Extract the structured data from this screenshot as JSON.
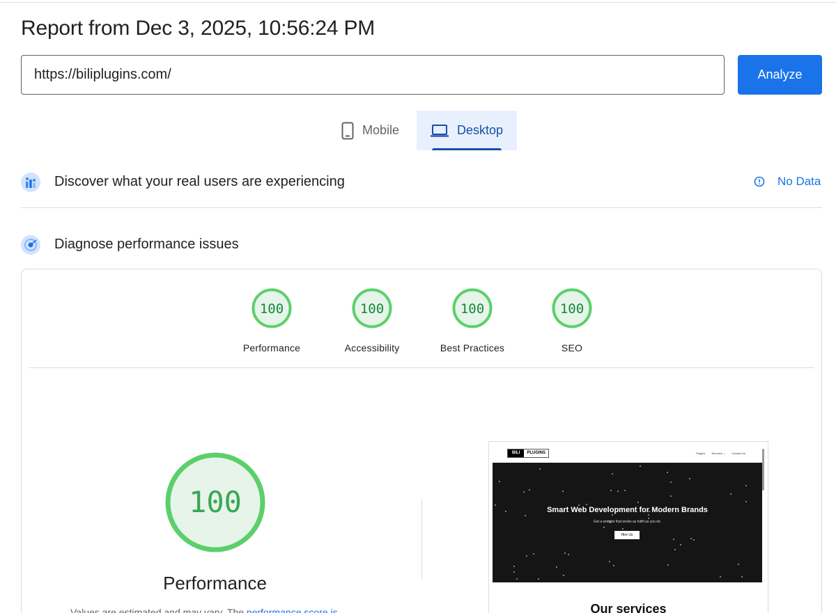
{
  "report": {
    "title": "Report from Dec 3, 2025, 10:56:24 PM"
  },
  "url_input": {
    "value": "https://biliplugins.com/"
  },
  "analyze_label": "Analyze",
  "tabs": [
    {
      "label": "Mobile",
      "icon": "phone-icon",
      "selected": false
    },
    {
      "label": "Desktop",
      "icon": "laptop-icon",
      "selected": true
    }
  ],
  "crux": {
    "title": "Discover what your real users are experiencing",
    "status": "No Data",
    "status_icon": "info-icon"
  },
  "diagnose": {
    "title": "Diagnose performance issues"
  },
  "scores": [
    {
      "label": "Performance",
      "value": "100"
    },
    {
      "label": "Accessibility",
      "value": "100"
    },
    {
      "label": "Best Practices",
      "value": "100"
    },
    {
      "label": "SEO",
      "value": "100"
    }
  ],
  "performance": {
    "score": "100",
    "label": "Performance",
    "note_prefix": "Values are estimated and may vary. The ",
    "note_link": "performance score is"
  },
  "screenshot": {
    "logo_left": "BILI",
    "logo_right": "PLUGINS",
    "menu": [
      "Plugins",
      "Services ⌄",
      "Contact Us"
    ],
    "headline": "Smart Web Development for Modern Brands",
    "subheadline": "Get a website that works as hard as you do.",
    "cta": "Hire Us",
    "section_heading": "Our services"
  },
  "colors": {
    "accent": "#1a73e8",
    "pass": "#0cce6b",
    "pass_text": "#008800",
    "pass_fill": "#e6f4ea"
  }
}
